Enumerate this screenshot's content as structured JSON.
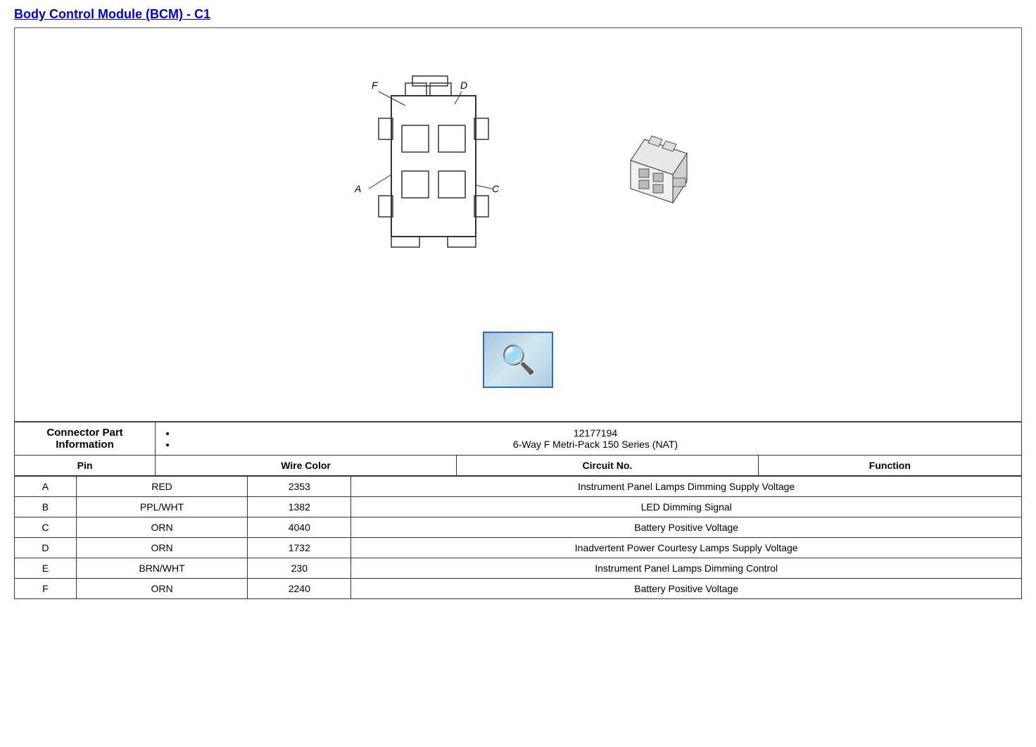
{
  "title": "Body Control Module (BCM) - C1",
  "diagram": {
    "labels": {
      "F": "F",
      "D": "D",
      "A": "A",
      "C": "C"
    }
  },
  "magnifier_label": "🔍",
  "connector_info": {
    "label": "Connector Part Information",
    "part_number": "12177194",
    "description": "6-Way F Metri-Pack 150 Series (NAT)"
  },
  "table_headers": {
    "pin": "Pin",
    "wire_color": "Wire Color",
    "circuit_no": "Circuit No.",
    "function": "Function"
  },
  "rows": [
    {
      "pin": "A",
      "wire_color": "RED",
      "circuit_no": "2353",
      "function": "Instrument Panel Lamps Dimming Supply Voltage"
    },
    {
      "pin": "B",
      "wire_color": "PPL/WHT",
      "circuit_no": "1382",
      "function": "LED Dimming Signal"
    },
    {
      "pin": "C",
      "wire_color": "ORN",
      "circuit_no": "4040",
      "function": "Battery Positive Voltage"
    },
    {
      "pin": "D",
      "wire_color": "ORN",
      "circuit_no": "1732",
      "function": "Inadvertent Power Courtesy Lamps Supply Voltage"
    },
    {
      "pin": "E",
      "wire_color": "BRN/WHT",
      "circuit_no": "230",
      "function": "Instrument Panel Lamps Dimming Control"
    },
    {
      "pin": "F",
      "wire_color": "ORN",
      "circuit_no": "2240",
      "function": "Battery Positive Voltage"
    }
  ]
}
